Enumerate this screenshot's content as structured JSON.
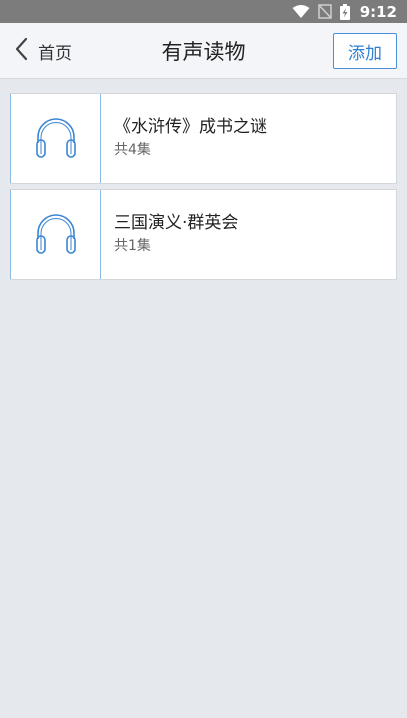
{
  "status_bar": {
    "time": "9:12",
    "icons": [
      "wifi-icon",
      "no-signal-icon",
      "battery-charging-icon"
    ]
  },
  "header": {
    "back_label": "首页",
    "title": "有声读物",
    "add_label": "添加"
  },
  "items": [
    {
      "title": "《水浒传》成书之谜",
      "count": "共4集",
      "icon": "headphones-icon"
    },
    {
      "title": "三国演义·群英会",
      "count": "共1集",
      "icon": "headphones-icon"
    }
  ],
  "colors": {
    "accent": "#2f7fd6",
    "icon_blue": "#3a86d4",
    "background": "#e5e8ec",
    "status_bar": "#7c7c7c"
  }
}
